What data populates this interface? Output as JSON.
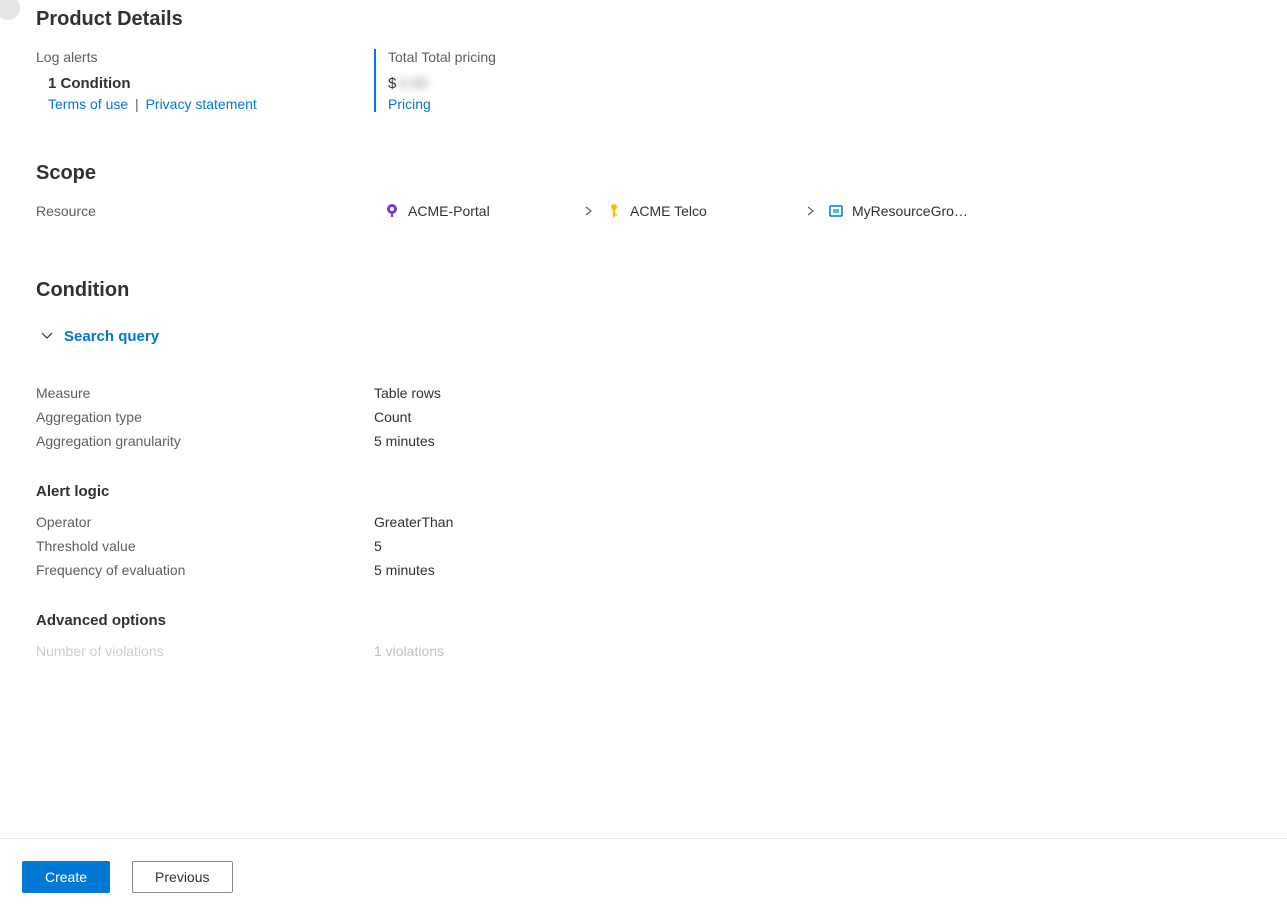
{
  "productDetails": {
    "heading": "Product Details",
    "leftLabel": "Log alerts",
    "conditionCount": "1 Condition",
    "termsLink": "Terms of use",
    "privacyLink": "Privacy statement",
    "separator": "|",
    "rightLabel": "Total Total pricing",
    "currency": "$",
    "priceHidden": "0.00",
    "pricingLink": "Pricing"
  },
  "scope": {
    "heading": "Scope",
    "label": "Resource",
    "breadcrumb": {
      "item1": "ACME-Portal",
      "item2": "ACME Telco",
      "item3": "MyResourceGro…"
    }
  },
  "condition": {
    "heading": "Condition",
    "searchQuery": "Search query",
    "fields": {
      "measureLabel": "Measure",
      "measureValue": "Table rows",
      "aggTypeLabel": "Aggregation type",
      "aggTypeValue": "Count",
      "aggGranLabel": "Aggregation granularity",
      "aggGranValue": "5 minutes"
    },
    "alertLogic": {
      "heading": "Alert logic",
      "operatorLabel": "Operator",
      "operatorValue": "GreaterThan",
      "thresholdLabel": "Threshold value",
      "thresholdValue": "5",
      "freqLabel": "Frequency of evaluation",
      "freqValue": "5 minutes"
    },
    "advanced": {
      "heading": "Advanced options",
      "violationsLabel": "Number of violations",
      "violationsValue": "1 violations"
    }
  },
  "footer": {
    "create": "Create",
    "previous": "Previous"
  }
}
